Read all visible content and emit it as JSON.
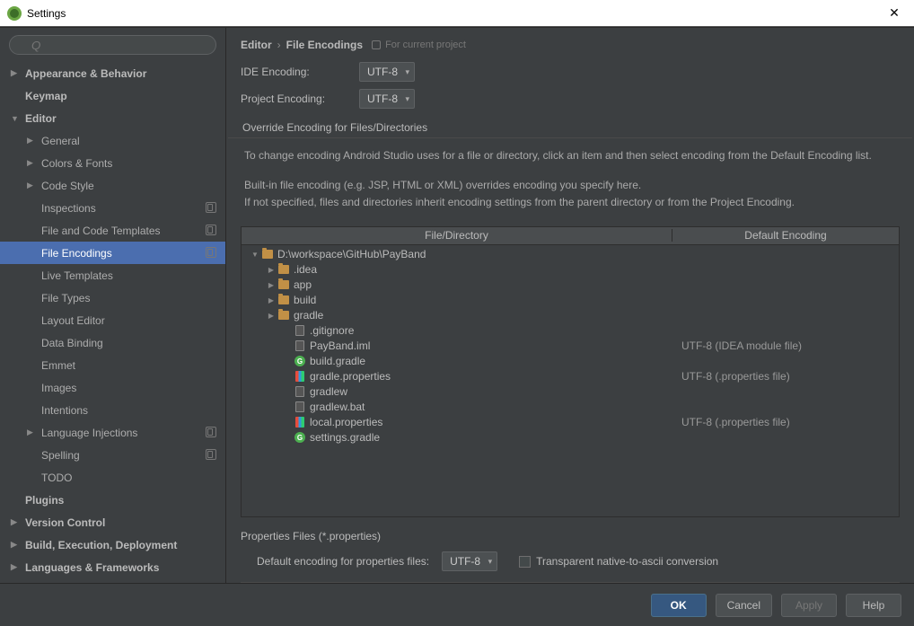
{
  "window": {
    "title": "Settings"
  },
  "search": {
    "placeholder": "Q"
  },
  "sidebar": {
    "items": [
      {
        "label": "Appearance & Behavior",
        "arrow": "right",
        "bold": true,
        "indent": 0
      },
      {
        "label": "Keymap",
        "arrow": "none",
        "bold": true,
        "indent": 0
      },
      {
        "label": "Editor",
        "arrow": "down",
        "bold": true,
        "indent": 0
      },
      {
        "label": "General",
        "arrow": "right",
        "bold": false,
        "indent": 1
      },
      {
        "label": "Colors & Fonts",
        "arrow": "right",
        "bold": false,
        "indent": 1
      },
      {
        "label": "Code Style",
        "arrow": "right",
        "bold": false,
        "indent": 1
      },
      {
        "label": "Inspections",
        "arrow": "none",
        "bold": false,
        "indent": 1,
        "status": true
      },
      {
        "label": "File and Code Templates",
        "arrow": "none",
        "bold": false,
        "indent": 1,
        "status": true
      },
      {
        "label": "File Encodings",
        "arrow": "none",
        "bold": false,
        "indent": 1,
        "selected": true,
        "status": true
      },
      {
        "label": "Live Templates",
        "arrow": "none",
        "bold": false,
        "indent": 1
      },
      {
        "label": "File Types",
        "arrow": "none",
        "bold": false,
        "indent": 1
      },
      {
        "label": "Layout Editor",
        "arrow": "none",
        "bold": false,
        "indent": 1
      },
      {
        "label": "Data Binding",
        "arrow": "none",
        "bold": false,
        "indent": 1
      },
      {
        "label": "Emmet",
        "arrow": "none",
        "bold": false,
        "indent": 1
      },
      {
        "label": "Images",
        "arrow": "none",
        "bold": false,
        "indent": 1
      },
      {
        "label": "Intentions",
        "arrow": "none",
        "bold": false,
        "indent": 1
      },
      {
        "label": "Language Injections",
        "arrow": "right",
        "bold": false,
        "indent": 1,
        "status": true
      },
      {
        "label": "Spelling",
        "arrow": "none",
        "bold": false,
        "indent": 1,
        "status": true
      },
      {
        "label": "TODO",
        "arrow": "none",
        "bold": false,
        "indent": 1
      },
      {
        "label": "Plugins",
        "arrow": "none",
        "bold": true,
        "indent": 0
      },
      {
        "label": "Version Control",
        "arrow": "right",
        "bold": true,
        "indent": 0
      },
      {
        "label": "Build, Execution, Deployment",
        "arrow": "right",
        "bold": true,
        "indent": 0
      },
      {
        "label": "Languages & Frameworks",
        "arrow": "right",
        "bold": true,
        "indent": 0
      }
    ]
  },
  "breadcrumb": {
    "root": "Editor",
    "leaf": "File Encodings",
    "note": "For current project"
  },
  "form": {
    "ide_label": "IDE Encoding:",
    "ide_value": "UTF-8",
    "proj_label": "Project Encoding:",
    "proj_value": "UTF-8"
  },
  "override": {
    "header": "Override Encoding for Files/Directories",
    "p1": "To change encoding Android Studio uses for a file or directory, click an item and then select encoding from the Default Encoding list.",
    "p2": "Built-in file encoding (e.g. JSP, HTML or XML) overrides encoding you specify here.",
    "p3": "If not specified, files and directories inherit encoding settings from the parent directory or from the Project Encoding."
  },
  "table": {
    "col_file": "File/Directory",
    "col_enc": "Default Encoding",
    "rows": [
      {
        "pad": 0,
        "arrow": "expanded",
        "icon": "folder",
        "name": "D:\\workspace\\GitHub\\PayBand",
        "enc": ""
      },
      {
        "pad": 1,
        "arrow": "collapsed",
        "icon": "folder",
        "name": ".idea",
        "enc": ""
      },
      {
        "pad": 1,
        "arrow": "collapsed",
        "icon": "folder",
        "name": "app",
        "enc": ""
      },
      {
        "pad": 1,
        "arrow": "collapsed",
        "icon": "folder",
        "name": "build",
        "enc": ""
      },
      {
        "pad": 1,
        "arrow": "collapsed",
        "icon": "folder",
        "name": "gradle",
        "enc": ""
      },
      {
        "pad": 2,
        "arrow": "leaf",
        "icon": "file",
        "name": ".gitignore",
        "enc": ""
      },
      {
        "pad": 2,
        "arrow": "leaf",
        "icon": "file",
        "name": "PayBand.iml",
        "enc": "UTF-8 (IDEA module file)"
      },
      {
        "pad": 2,
        "arrow": "leaf",
        "icon": "gradle",
        "name": "build.gradle",
        "enc": ""
      },
      {
        "pad": 2,
        "arrow": "leaf",
        "icon": "prop",
        "name": "gradle.properties",
        "enc": "UTF-8 (.properties file)"
      },
      {
        "pad": 2,
        "arrow": "leaf",
        "icon": "file",
        "name": "gradlew",
        "enc": ""
      },
      {
        "pad": 2,
        "arrow": "leaf",
        "icon": "file",
        "name": "gradlew.bat",
        "enc": ""
      },
      {
        "pad": 2,
        "arrow": "leaf",
        "icon": "prop",
        "name": "local.properties",
        "enc": "UTF-8 (.properties file)"
      },
      {
        "pad": 2,
        "arrow": "leaf",
        "icon": "gradle",
        "name": "settings.gradle",
        "enc": ""
      }
    ]
  },
  "properties": {
    "header": "Properties Files (*.properties)",
    "label": "Default encoding for properties files:",
    "value": "UTF-8",
    "checkbox_label": "Transparent native-to-ascii conversion"
  },
  "buttons": {
    "ok": "OK",
    "cancel": "Cancel",
    "apply": "Apply",
    "help": "Help"
  }
}
